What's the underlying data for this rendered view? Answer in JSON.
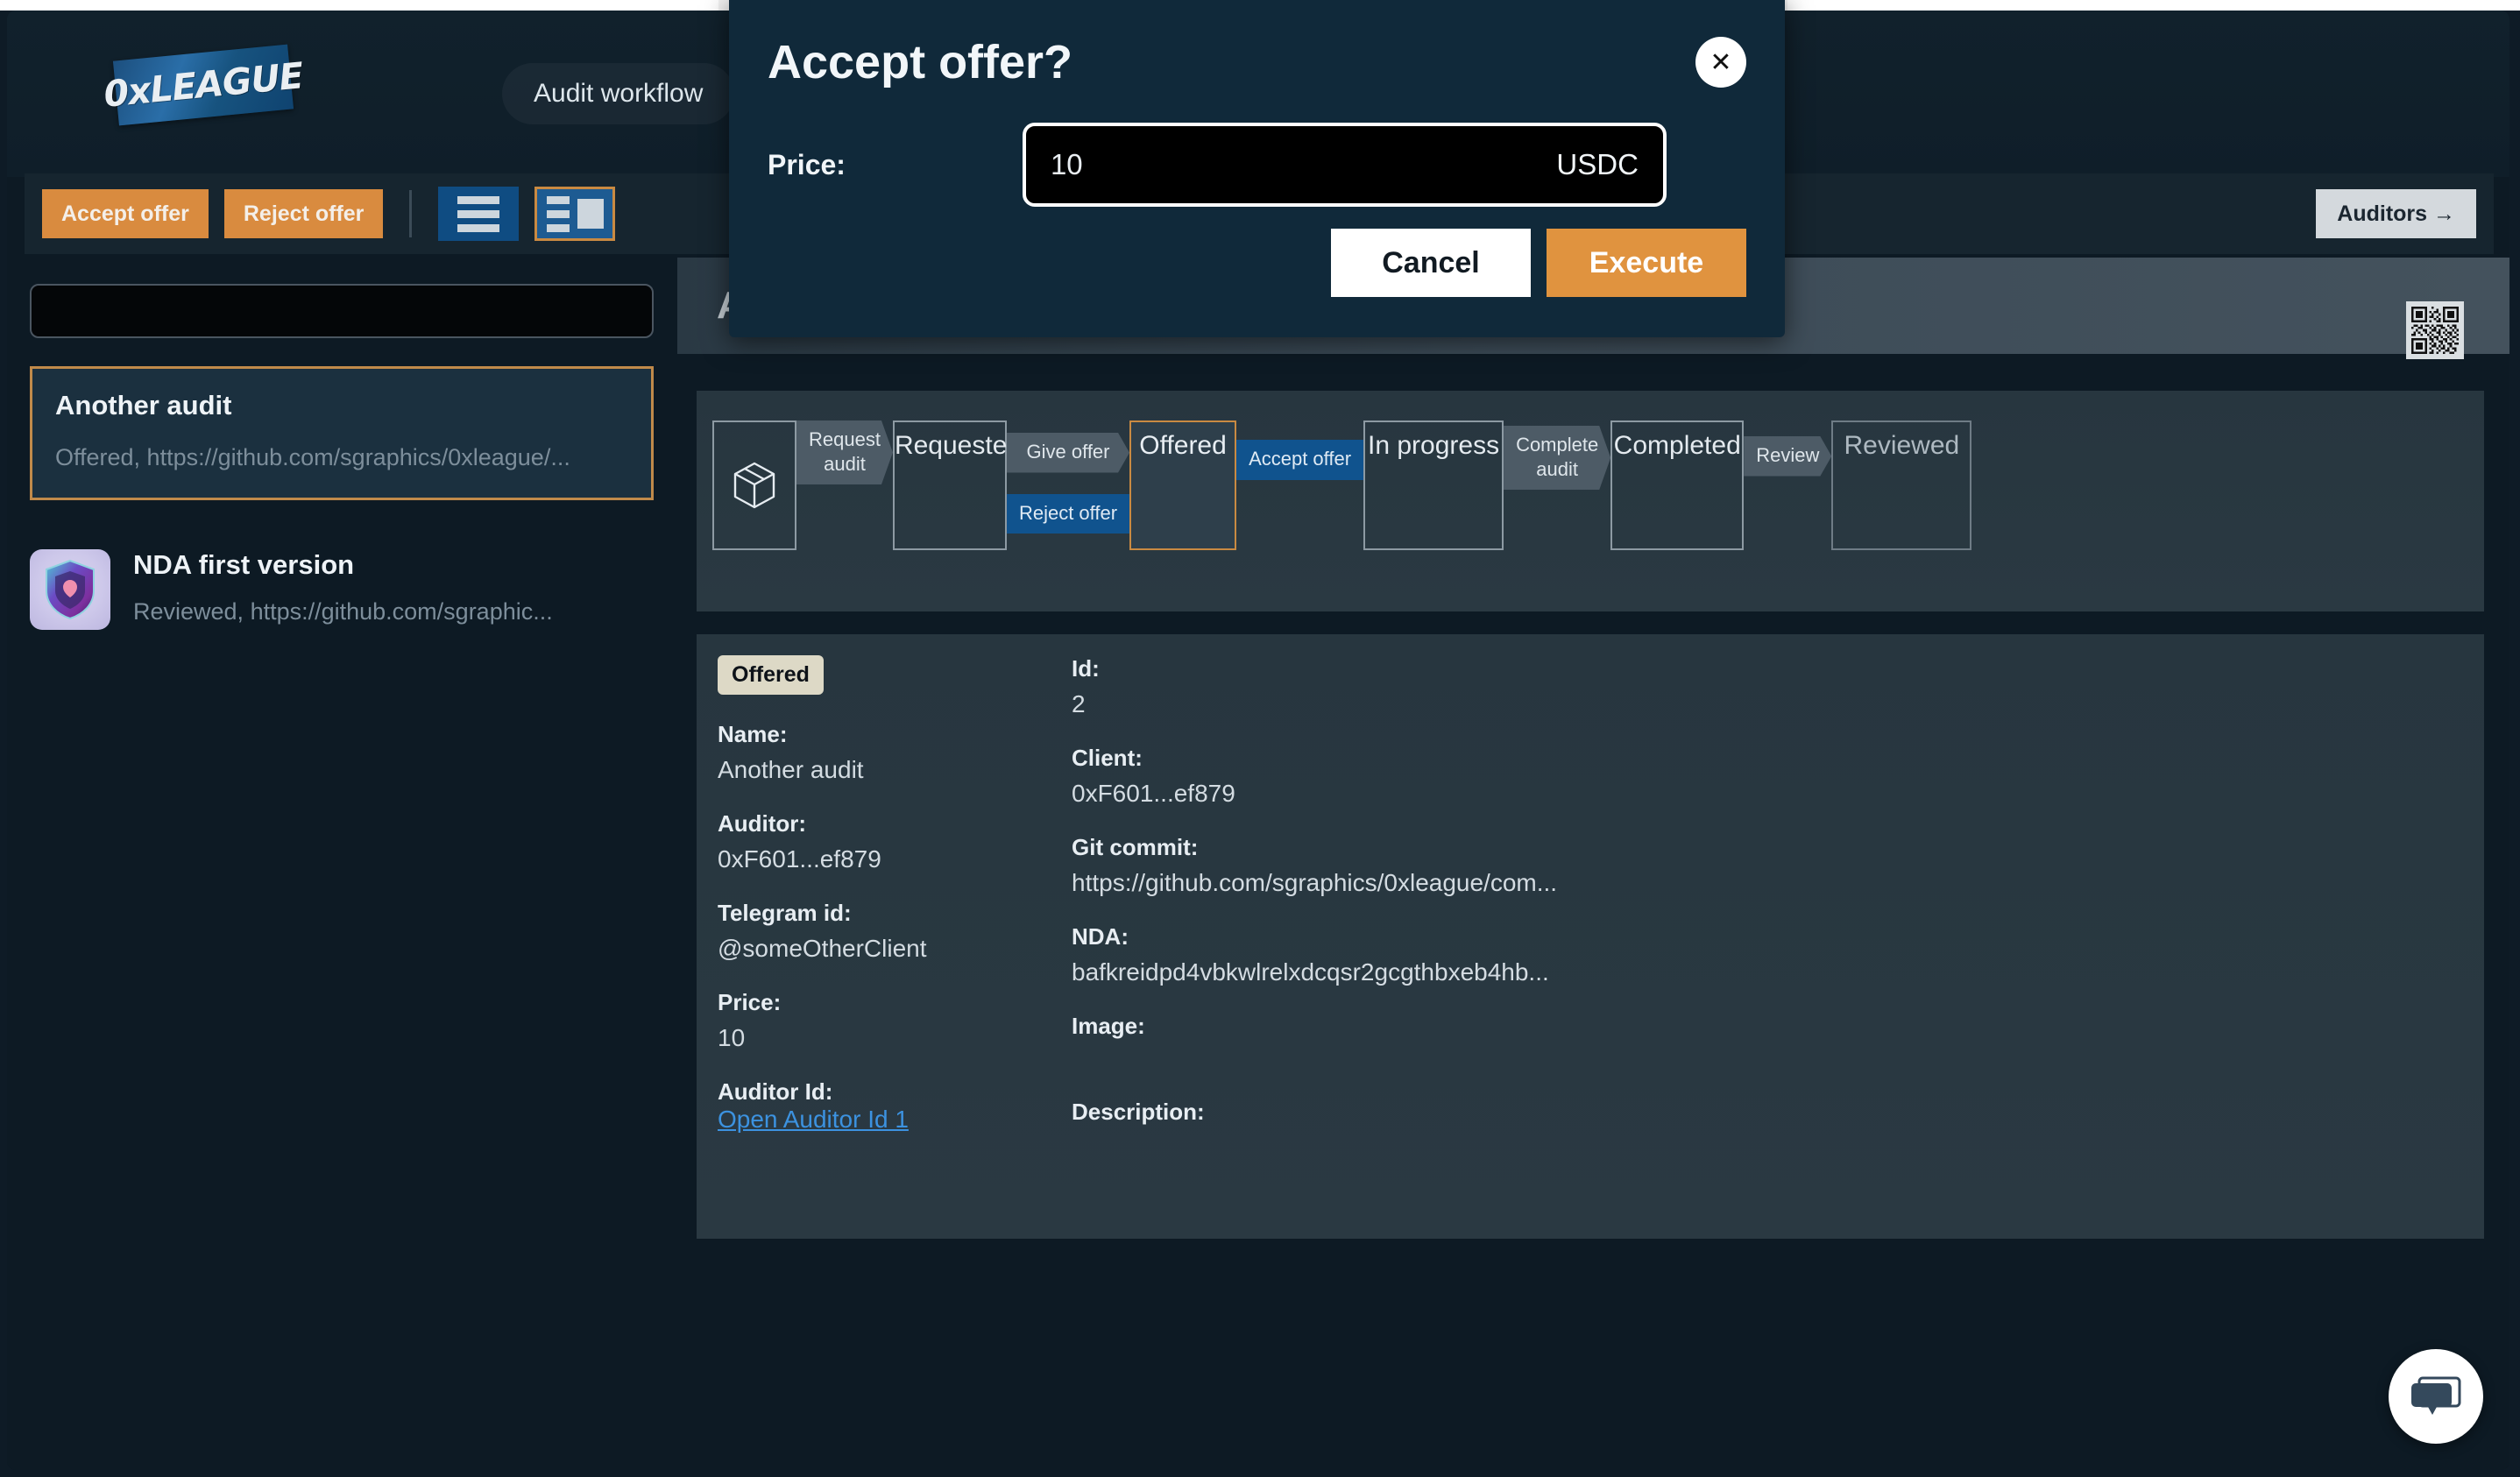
{
  "app": {
    "logo_text": "0xLEAGUE",
    "workflow_pill": "Audit workflow"
  },
  "toolbar": {
    "accept_offer": "Accept offer",
    "reject_offer": "Reject offer",
    "view_list_icon": "list-view-icon",
    "view_split_icon": "split-view-icon",
    "auditors_button": "Auditors →"
  },
  "sidebar": {
    "search_value": "",
    "search_placeholder": "",
    "items": [
      {
        "title": "Another audit",
        "subtitle": "Offered, https://github.com/sgraphics/0xleague/...",
        "has_thumb": false,
        "active": true
      },
      {
        "title": "NDA first version",
        "subtitle": "Reviewed, https://github.com/sgraphic...",
        "has_thumb": true,
        "active": false
      }
    ]
  },
  "main": {
    "page_title": "Another audit",
    "qr_icon": "qr-code-icon",
    "workflow": {
      "start_icon": "package-cube-icon",
      "nodes": [
        {
          "label": "",
          "state": "start"
        },
        {
          "label": "Requested",
          "state": "normal"
        },
        {
          "label": "Offered",
          "state": "current"
        },
        {
          "label": "In progress",
          "state": "normal"
        },
        {
          "label": "Completed",
          "state": "normal"
        },
        {
          "label": "Reviewed",
          "state": "dim"
        }
      ],
      "edges": [
        {
          "labels": [
            {
              "text": "Request\naudit",
              "color": "gray"
            }
          ]
        },
        {
          "labels": [
            {
              "text": "Give offer",
              "color": "gray"
            },
            {
              "text": "Reject offer",
              "color": "blue"
            }
          ]
        },
        {
          "labels": [
            {
              "text": "Accept offer",
              "color": "blue"
            }
          ]
        },
        {
          "labels": [
            {
              "text": "Complete\naudit",
              "color": "gray"
            }
          ]
        },
        {
          "labels": [
            {
              "text": "Review",
              "color": "gray"
            }
          ]
        }
      ]
    },
    "detail": {
      "status_badge": "Offered",
      "left_fields": [
        {
          "label": "Name:",
          "value": "Another audit",
          "type": "text"
        },
        {
          "label": "Auditor:",
          "value": "0xF601...ef879",
          "type": "text"
        },
        {
          "label": "Telegram id:",
          "value": "@someOtherClient",
          "type": "text"
        },
        {
          "label": "Price:",
          "value": "10",
          "type": "text"
        },
        {
          "label": "Auditor Id:",
          "value": "Open Auditor Id 1",
          "type": "link"
        }
      ],
      "right_fields": [
        {
          "label": "Id:",
          "value": "2",
          "type": "text"
        },
        {
          "label": "Client:",
          "value": "0xF601...ef879",
          "type": "text"
        },
        {
          "label": "Git commit:",
          "value": "https://github.com/sgraphics/0xleague/com...",
          "type": "text"
        },
        {
          "label": "NDA:",
          "value": "bafkreidpd4vbkwlrelxdcqsr2gcgthbxeb4hb...",
          "type": "text"
        },
        {
          "label": "Image:",
          "value": "",
          "type": "text"
        },
        {
          "label": "Description:",
          "value": "",
          "type": "text"
        }
      ]
    }
  },
  "modal": {
    "title": "Accept offer?",
    "close_icon": "close-icon",
    "price_label": "Price:",
    "price_value": "10",
    "price_placeholder": "",
    "price_unit": "USDC",
    "cancel": "Cancel",
    "execute": "Execute"
  },
  "chat": {
    "icon": "chat-bubble-icon"
  },
  "colors": {
    "accent_orange": "#d98b3f",
    "accent_blue": "#0f4c82",
    "panel": "#27363f",
    "background": "#0d1a24",
    "link": "#3c92e0",
    "badge_bg": "#ddd9c6"
  }
}
